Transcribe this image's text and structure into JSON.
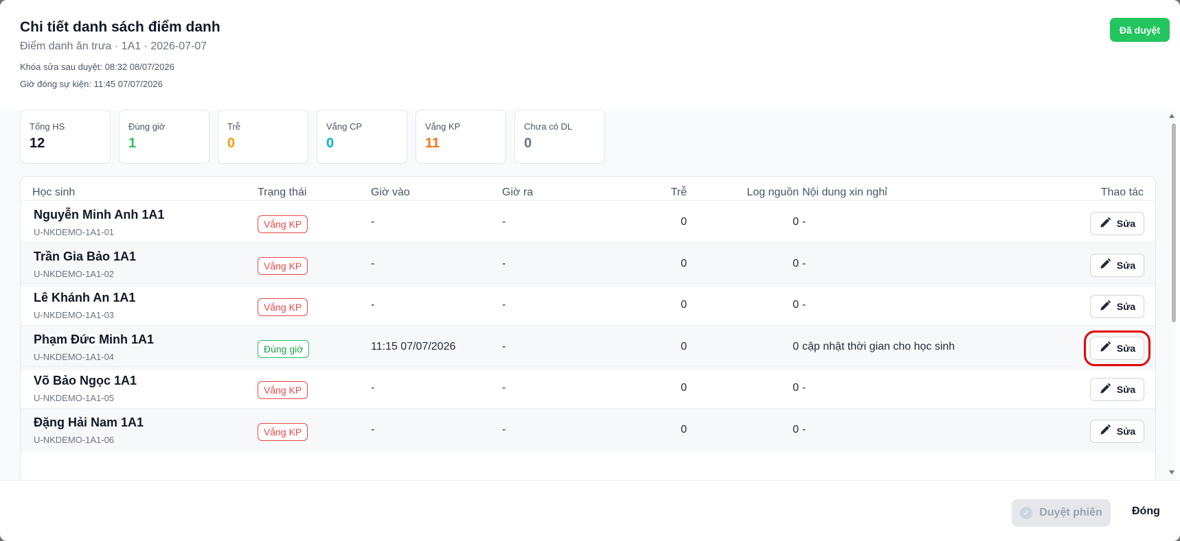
{
  "header": {
    "title": "Chi tiết danh sách điểm danh",
    "subtitle": "Điểm danh ăn trưa · 1A1 · 2026-07-07",
    "lock_info": "Khóa sửa sau duyệt: 08:32 08/07/2026",
    "close_time": "Giờ đóng sự kiện: 11:45 07/07/2026",
    "status_badge": "Đã duyệt"
  },
  "stats": [
    {
      "label": "Tổng HS",
      "value": "12",
      "color": "#111827"
    },
    {
      "label": "Đúng giờ",
      "value": "1",
      "color": "#22c55e"
    },
    {
      "label": "Trễ",
      "value": "0",
      "color": "#f59e0b"
    },
    {
      "label": "Vắng CP",
      "value": "0",
      "color": "#06b6d4"
    },
    {
      "label": "Vắng KP",
      "value": "11",
      "color": "#f97316"
    },
    {
      "label": "Chưa có DL",
      "value": "0",
      "color": "#64748b"
    }
  ],
  "table": {
    "columns": {
      "student": "Học sinh",
      "status": "Trạng thái",
      "time_in": "Giờ vào",
      "time_out": "Giờ ra",
      "late": "Trễ",
      "log_source": "Log nguồn",
      "leave_note": "Nội dung xin nghỉ",
      "actions": "Thao tác"
    },
    "edit_label": "Sửa",
    "rows": [
      {
        "name": "Nguyễn Minh Anh 1A1",
        "code": "U-NKDEMO-1A1-01",
        "status": "Vắng KP",
        "time_in": "-",
        "time_out": "-",
        "late": "0",
        "log": "0",
        "note": "-"
      },
      {
        "name": "Trần Gia Bảo 1A1",
        "code": "U-NKDEMO-1A1-02",
        "status": "Vắng KP",
        "time_in": "-",
        "time_out": "-",
        "late": "0",
        "log": "0",
        "note": "-"
      },
      {
        "name": "Lê Khánh An 1A1",
        "code": "U-NKDEMO-1A1-03",
        "status": "Vắng KP",
        "time_in": "-",
        "time_out": "-",
        "late": "0",
        "log": "0",
        "note": "-"
      },
      {
        "name": "Phạm Đức Minh 1A1",
        "code": "U-NKDEMO-1A1-04",
        "status": "Đúng giờ",
        "time_in": "11:15 07/07/2026",
        "time_out": "-",
        "late": "0",
        "log": "0",
        "note": "cập nhật thời gian cho học sinh"
      },
      {
        "name": "Võ Bảo Ngọc 1A1",
        "code": "U-NKDEMO-1A1-05",
        "status": "Vắng KP",
        "time_in": "-",
        "time_out": "-",
        "late": "0",
        "log": "0",
        "note": "-"
      },
      {
        "name": "Đặng Hải Nam 1A1",
        "code": "U-NKDEMO-1A1-06",
        "status": "Vắng KP",
        "time_in": "-",
        "time_out": "-",
        "late": "0",
        "log": "0",
        "note": "-"
      }
    ]
  },
  "footer": {
    "approve_label": "Duyệt phiên",
    "close_label": "Đóng"
  }
}
